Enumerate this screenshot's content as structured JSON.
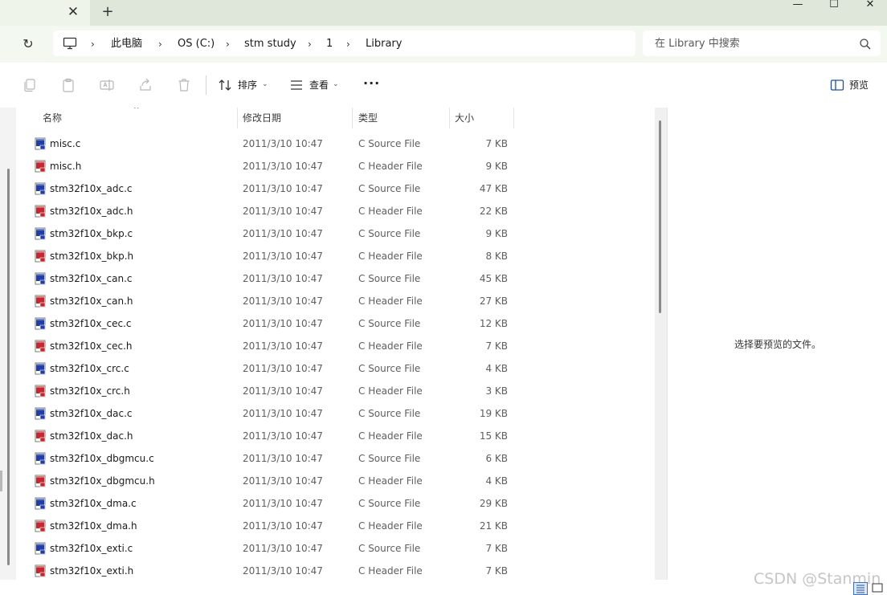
{
  "titlebar": {
    "tab_close": "✕",
    "tab_add": "+",
    "minimize": "—",
    "maximize": "☐",
    "close": "✕"
  },
  "nav": {
    "refresh_icon": "↻",
    "breadcrumb": [
      "此电脑",
      "OS (C:)",
      "stm study",
      "1",
      "Library"
    ],
    "separator": "›",
    "search_placeholder": "在 Library 中搜索"
  },
  "commandbar": {
    "sort_label": "排序",
    "view_label": "查看",
    "more_label": "···",
    "preview_label": "预览",
    "dropdown_caret": "⌄"
  },
  "table": {
    "headers": {
      "name": "名称",
      "date": "修改日期",
      "type": "类型",
      "size": "大小"
    },
    "sort_indicator": "^",
    "rows": [
      {
        "name": "misc.c",
        "date": "2011/3/10 10:47",
        "type": "C Source File",
        "size": "7 KB",
        "kind": "c"
      },
      {
        "name": "misc.h",
        "date": "2011/3/10 10:47",
        "type": "C Header File",
        "size": "9 KB",
        "kind": "h"
      },
      {
        "name": "stm32f10x_adc.c",
        "date": "2011/3/10 10:47",
        "type": "C Source File",
        "size": "47 KB",
        "kind": "c"
      },
      {
        "name": "stm32f10x_adc.h",
        "date": "2011/3/10 10:47",
        "type": "C Header File",
        "size": "22 KB",
        "kind": "h"
      },
      {
        "name": "stm32f10x_bkp.c",
        "date": "2011/3/10 10:47",
        "type": "C Source File",
        "size": "9 KB",
        "kind": "c"
      },
      {
        "name": "stm32f10x_bkp.h",
        "date": "2011/3/10 10:47",
        "type": "C Header File",
        "size": "8 KB",
        "kind": "h"
      },
      {
        "name": "stm32f10x_can.c",
        "date": "2011/3/10 10:47",
        "type": "C Source File",
        "size": "45 KB",
        "kind": "c"
      },
      {
        "name": "stm32f10x_can.h",
        "date": "2011/3/10 10:47",
        "type": "C Header File",
        "size": "27 KB",
        "kind": "h"
      },
      {
        "name": "stm32f10x_cec.c",
        "date": "2011/3/10 10:47",
        "type": "C Source File",
        "size": "12 KB",
        "kind": "c"
      },
      {
        "name": "stm32f10x_cec.h",
        "date": "2011/3/10 10:47",
        "type": "C Header File",
        "size": "7 KB",
        "kind": "h"
      },
      {
        "name": "stm32f10x_crc.c",
        "date": "2011/3/10 10:47",
        "type": "C Source File",
        "size": "4 KB",
        "kind": "c"
      },
      {
        "name": "stm32f10x_crc.h",
        "date": "2011/3/10 10:47",
        "type": "C Header File",
        "size": "3 KB",
        "kind": "h"
      },
      {
        "name": "stm32f10x_dac.c",
        "date": "2011/3/10 10:47",
        "type": "C Source File",
        "size": "19 KB",
        "kind": "c"
      },
      {
        "name": "stm32f10x_dac.h",
        "date": "2011/3/10 10:47",
        "type": "C Header File",
        "size": "15 KB",
        "kind": "h"
      },
      {
        "name": "stm32f10x_dbgmcu.c",
        "date": "2011/3/10 10:47",
        "type": "C Source File",
        "size": "6 KB",
        "kind": "c"
      },
      {
        "name": "stm32f10x_dbgmcu.h",
        "date": "2011/3/10 10:47",
        "type": "C Header File",
        "size": "4 KB",
        "kind": "h"
      },
      {
        "name": "stm32f10x_dma.c",
        "date": "2011/3/10 10:47",
        "type": "C Source File",
        "size": "29 KB",
        "kind": "c"
      },
      {
        "name": "stm32f10x_dma.h",
        "date": "2011/3/10 10:47",
        "type": "C Header File",
        "size": "21 KB",
        "kind": "h"
      },
      {
        "name": "stm32f10x_exti.c",
        "date": "2011/3/10 10:47",
        "type": "C Source File",
        "size": "7 KB",
        "kind": "c"
      },
      {
        "name": "stm32f10x_exti.h",
        "date": "2011/3/10 10:47",
        "type": "C Header File",
        "size": "7 KB",
        "kind": "h"
      }
    ]
  },
  "preview_pane": {
    "message": "选择要预览的文件。"
  },
  "watermark": "CSDN @Stanmin",
  "colors": {
    "source_icon": "#1f3fa8",
    "header_icon": "#c8262e",
    "chrome": "#f3f8f0",
    "tabbar": "#dfe7db"
  }
}
